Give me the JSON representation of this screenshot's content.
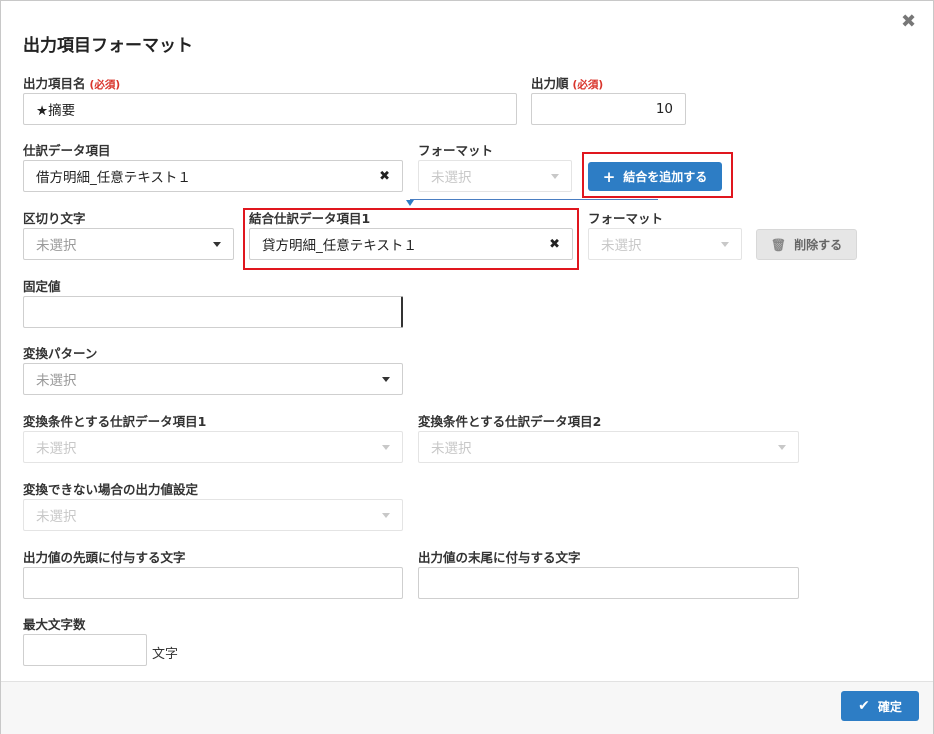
{
  "dialog": {
    "title": "出力項目フォーマット",
    "close_label": "✖"
  },
  "output_name": {
    "label": "出力項目名",
    "required": "(必須)",
    "value": "★摘要"
  },
  "output_order": {
    "label": "出力順",
    "required": "(必須)",
    "value": "10"
  },
  "journal_item": {
    "label": "仕訳データ項目",
    "value": "借方明細_任意テキスト１"
  },
  "format1": {
    "label": "フォーマット",
    "placeholder": "未選択"
  },
  "add_join_button": {
    "label": "結合を追加する"
  },
  "delimiter": {
    "label": "区切り文字",
    "placeholder": "未選択"
  },
  "joined_item1": {
    "label": "結合仕訳データ項目1",
    "value": "貸方明細_任意テキスト１"
  },
  "format2": {
    "label": "フォーマット",
    "placeholder": "未選択"
  },
  "delete_button": {
    "label": "削除する"
  },
  "fixed_value": {
    "label": "固定値",
    "value": ""
  },
  "conversion_pattern": {
    "label": "変換パターン",
    "placeholder": "未選択"
  },
  "condition_item1": {
    "label": "変換条件とする仕訳データ項目1",
    "placeholder": "未選択"
  },
  "condition_item2": {
    "label": "変換条件とする仕訳データ項目2",
    "placeholder": "未選択"
  },
  "fallback_output": {
    "label": "変換できない場合の出力値設定",
    "placeholder": "未選択"
  },
  "prefix": {
    "label": "出力値の先頭に付与する文字",
    "value": ""
  },
  "suffix": {
    "label": "出力値の末尾に付与する文字",
    "value": ""
  },
  "max_chars": {
    "label": "最大文字数",
    "value": "",
    "unit": "文字"
  },
  "confirm_button": {
    "label": "確定"
  },
  "colors": {
    "primary": "#2d7dc5",
    "required": "#d9342b",
    "highlight": "#e0161e"
  }
}
